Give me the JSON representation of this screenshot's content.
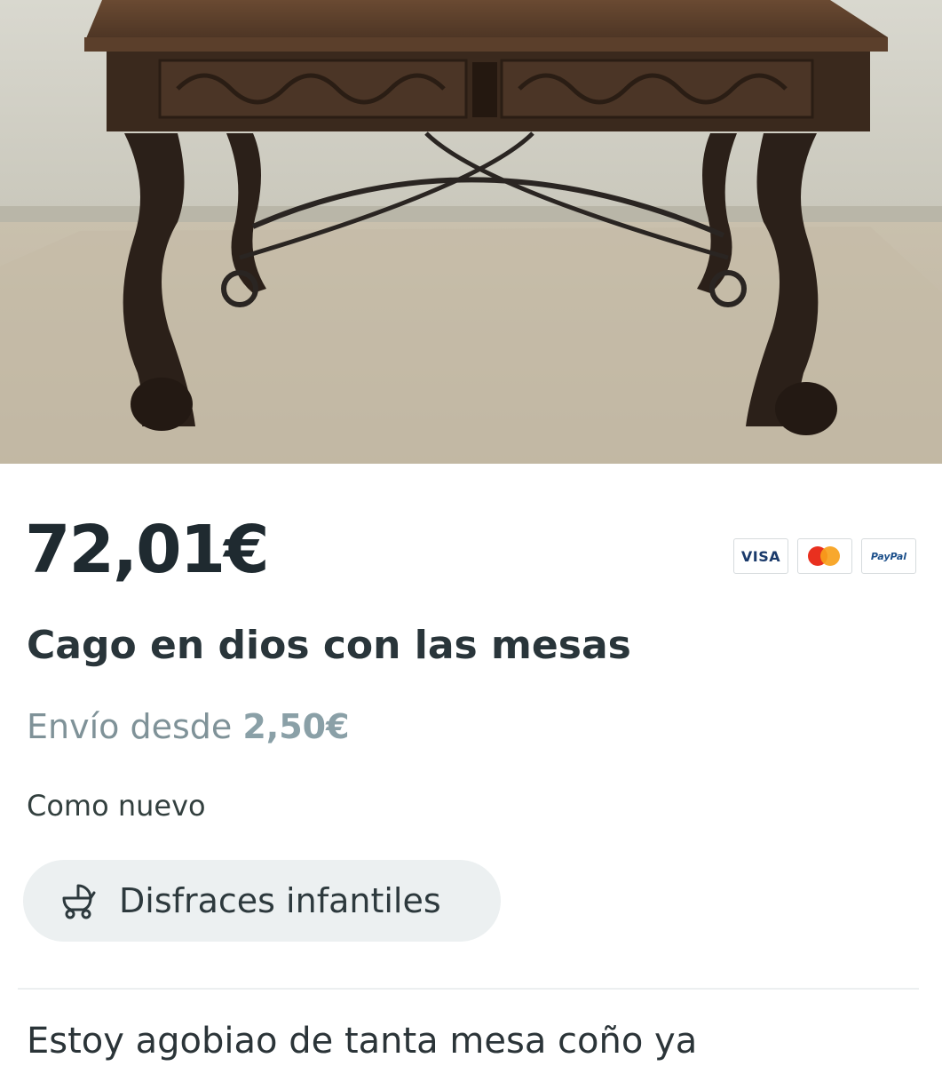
{
  "listing": {
    "price": "72,01€",
    "title": "Cago en dios con las mesas",
    "shipping_prefix": "Envío desde",
    "shipping_price": "2,50€",
    "condition": "Como nuevo",
    "category": "Disfraces infantiles",
    "category_icon": "baby-stroller-icon",
    "description": "Estoy agobiao de tanta mesa coño ya"
  },
  "payments": {
    "visa_label": "VISA",
    "mastercard_icon": "mastercard-logo",
    "paypal_label": "PayPal"
  },
  "photo": {
    "subject": "carved-wooden-desk-photo"
  },
  "colors": {
    "text_dark": "#1f2a30",
    "shipping_text": "#7f9298",
    "chip_background": "#ecf0f1"
  }
}
